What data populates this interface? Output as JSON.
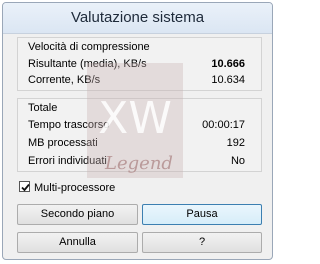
{
  "window": {
    "title": "Valutazione sistema"
  },
  "compression": {
    "legend": "Velocità di compressione",
    "rows": [
      {
        "label": "Risultante (media), KB/s",
        "value": "10.666"
      },
      {
        "label": "Corrente, KB/s",
        "value": "10.634"
      }
    ]
  },
  "totals": {
    "legend": "Totale",
    "rows": [
      {
        "label": "Tempo trascorso",
        "value": "00:00:17"
      },
      {
        "label": "MB processati",
        "value": "192"
      },
      {
        "label": "Errori individuati",
        "value": "No"
      }
    ]
  },
  "watermark": {
    "letters": "XW",
    "word": "Legend"
  },
  "options": {
    "multiprocessor_label": "Multi-processore",
    "multiprocessor_checked": true
  },
  "buttons": {
    "background": "Secondo piano",
    "pause": "Pausa",
    "cancel": "Annulla",
    "help": "?"
  }
}
